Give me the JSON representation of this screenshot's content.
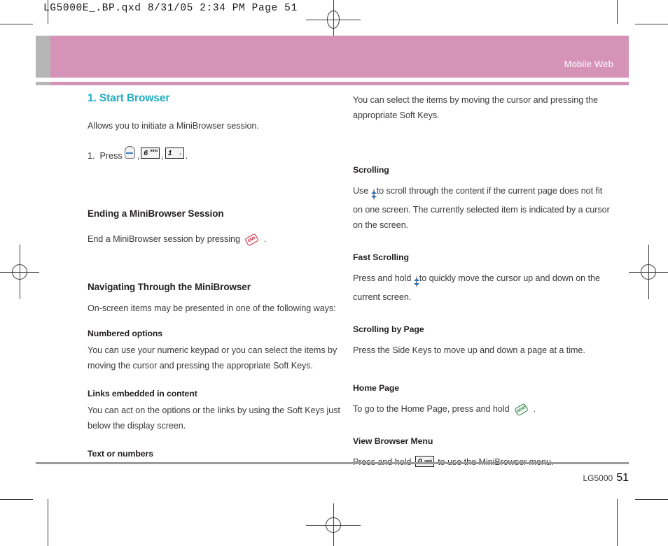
{
  "proof": {
    "slugline": "LG5000E_.BP.qxd   8/31/05   2:34 PM   Page 51"
  },
  "header": {
    "title": "Mobile Web"
  },
  "left_column": {
    "section_title": "1. Start Browser",
    "intro": "Allows you to initiate a MiniBrowser session.",
    "step": {
      "number": "1.",
      "lead": "Press",
      "comma1": ",",
      "comma2": ",",
      "period": ".",
      "keys": [
        {
          "type": "round-key",
          "name": "ok-key"
        },
        {
          "type": "numeric-key",
          "digit": "6",
          "letters": "mno"
        },
        {
          "type": "numeric-key",
          "digit": "1",
          "letters": ""
        }
      ]
    },
    "ending_heading": "Ending a MiniBrowser Session",
    "ending_text_before": "End a MiniBrowser session by pressing",
    "ending_text_after": ".",
    "ending_key_label": "END",
    "navigating_heading": "Navigating Through the MiniBrowser",
    "navigating_text": "On-screen items may be presented in one of the following ways:",
    "numbered_heading": "Numbered options",
    "numbered_text": "You can use your numeric keypad or you can select the items by moving the cursor and pressing the appropriate Soft Keys.",
    "links_heading": "Links embedded in content",
    "links_text": "You can act on the options or the links by using the Soft Keys just below the display screen.",
    "text_heading": "Text or numbers"
  },
  "right_column": {
    "text_top": "You can select the items by moving the cursor and pressing the appropriate Soft Keys.",
    "scrolling_heading": "Scrolling",
    "scrolling_text_before": "Use",
    "scrolling_text_after": "to scroll through the content if the current page does not fit on one screen. The currently selected item is indicated by a cursor on the screen.",
    "fast_scrolling_heading": "Fast Scrolling",
    "fast_scrolling_before": "Press and hold",
    "fast_scrolling_after": "to quickly move the cursor up and down on the current screen.",
    "scrolling_page_heading": "Scrolling by Page",
    "scrolling_page_text": "Press the Side Keys to move up and down a page at a time.",
    "home_page_heading": "Home Page",
    "home_page_before": "To go to the Home Page, press and hold",
    "home_page_after": ".",
    "home_page_key_label": "SEND",
    "view_menu_heading": "View Browser Menu",
    "view_menu_before": "Press and hold",
    "view_menu_after": "to use the MiniBrowser menu.",
    "view_menu_key": {
      "digit": "0",
      "letters": "next"
    }
  },
  "footer": {
    "model": "LG5000",
    "page_number": "51"
  },
  "colors": {
    "header_pink": "#d693b8",
    "header_tab_gray": "#b6b6b6",
    "section_title_teal": "#23adc3",
    "footer_rule_gray": "#9b9b9b",
    "body_text": "#3a3a3a"
  }
}
